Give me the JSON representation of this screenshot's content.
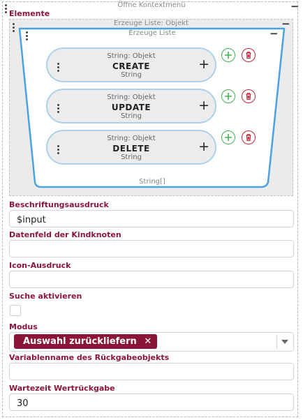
{
  "context_menu": {
    "title": "Öffne Kontextmenü"
  },
  "elements": {
    "label": "Elemente",
    "outer_list_title": "Erzeuge Liste: Objekt",
    "inner_list_title": "Erzeuge Liste",
    "list_type": "String[]",
    "items": [
      {
        "type_label": "String: Objekt",
        "value": "CREATE",
        "sub_label": "String"
      },
      {
        "type_label": "String: Objekt",
        "value": "UPDATE",
        "sub_label": "String"
      },
      {
        "type_label": "String: Objekt",
        "value": "DELETE",
        "sub_label": "String"
      }
    ]
  },
  "fields": {
    "beschriftung": {
      "label": "Beschriftungsausdruck",
      "value": "$input"
    },
    "datenfeld": {
      "label": "Datenfeld der Kindknoten",
      "value": ""
    },
    "icon": {
      "label": "Icon-Ausdruck",
      "value": ""
    },
    "suche": {
      "label": "Suche aktivieren",
      "checked": false
    },
    "modus": {
      "label": "Modus",
      "selected": "Auswahl zurückliefern"
    },
    "variablenname": {
      "label": "Variablenname des Rückgabeobjekts",
      "value": ""
    },
    "wartezeit": {
      "label": "Wartezeit Wertrückgabe",
      "value": "30"
    }
  },
  "colors": {
    "label": "#8b1538",
    "chip": "#8b1538",
    "card_border": "#a9d1e9",
    "add": "#3fb34f",
    "delete": "#c0283a"
  },
  "icons": {
    "add": "plus-circle-icon",
    "delete": "trash-icon",
    "drag": "kebab-icon",
    "collapse": "minus-icon",
    "expand": "plus-icon"
  }
}
